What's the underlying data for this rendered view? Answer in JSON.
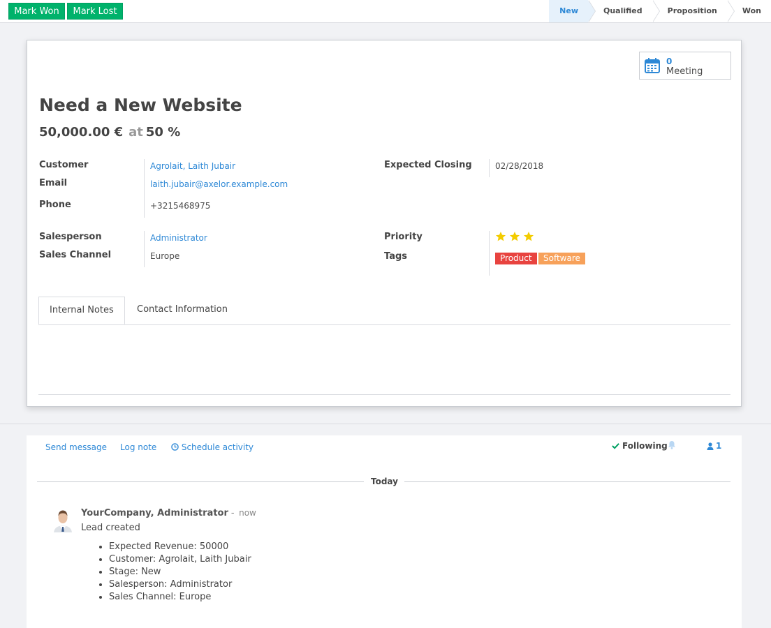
{
  "statusbar": {
    "mark_won": "Mark Won",
    "mark_lost": "Mark Lost",
    "stages": [
      "New",
      "Qualified",
      "Proposition",
      "Won"
    ],
    "active_stage": "New"
  },
  "smart_button": {
    "count": "0",
    "label": "Meeting",
    "icon": "calendar-icon"
  },
  "lead": {
    "title": "Need a New Website",
    "revenue": "50,000.00 €",
    "at": "at",
    "probability": "50 %"
  },
  "fields": {
    "customer_label": "Customer",
    "customer_value": "Agrolait, Laith Jubair",
    "email_label": "Email",
    "email_value": "laith.jubair@axelor.example.com",
    "phone_label": "Phone",
    "phone_value": "+3215468975",
    "expected_closing_label": "Expected Closing",
    "expected_closing_value": "02/28/2018",
    "salesperson_label": "Salesperson",
    "salesperson_value": "Administrator",
    "sales_channel_label": "Sales Channel",
    "sales_channel_value": "Europe",
    "priority_label": "Priority",
    "priority_stars": 3,
    "tags_label": "Tags",
    "tags": [
      {
        "label": "Product",
        "color": "#e8433f"
      },
      {
        "label": "Software",
        "color": "#f7a15a"
      }
    ]
  },
  "tabs": [
    "Internal Notes",
    "Contact Information"
  ],
  "chatter": {
    "send_message": "Send message",
    "log_note": "Log note",
    "schedule_activity": "Schedule activity",
    "following": "Following",
    "followers_count": "1",
    "day": "Today",
    "message": {
      "author": "YourCompany, Administrator",
      "dash": "-",
      "time": "now",
      "body": "Lead created",
      "changes": [
        "Expected Revenue: 50000",
        "Customer: Agrolait, Laith Jubair",
        "Stage: New",
        "Salesperson: Administrator",
        "Sales Channel: Europe"
      ]
    }
  },
  "colors": {
    "accent": "#2d88d6",
    "success": "#00b26b",
    "star": "#f3cc00"
  }
}
